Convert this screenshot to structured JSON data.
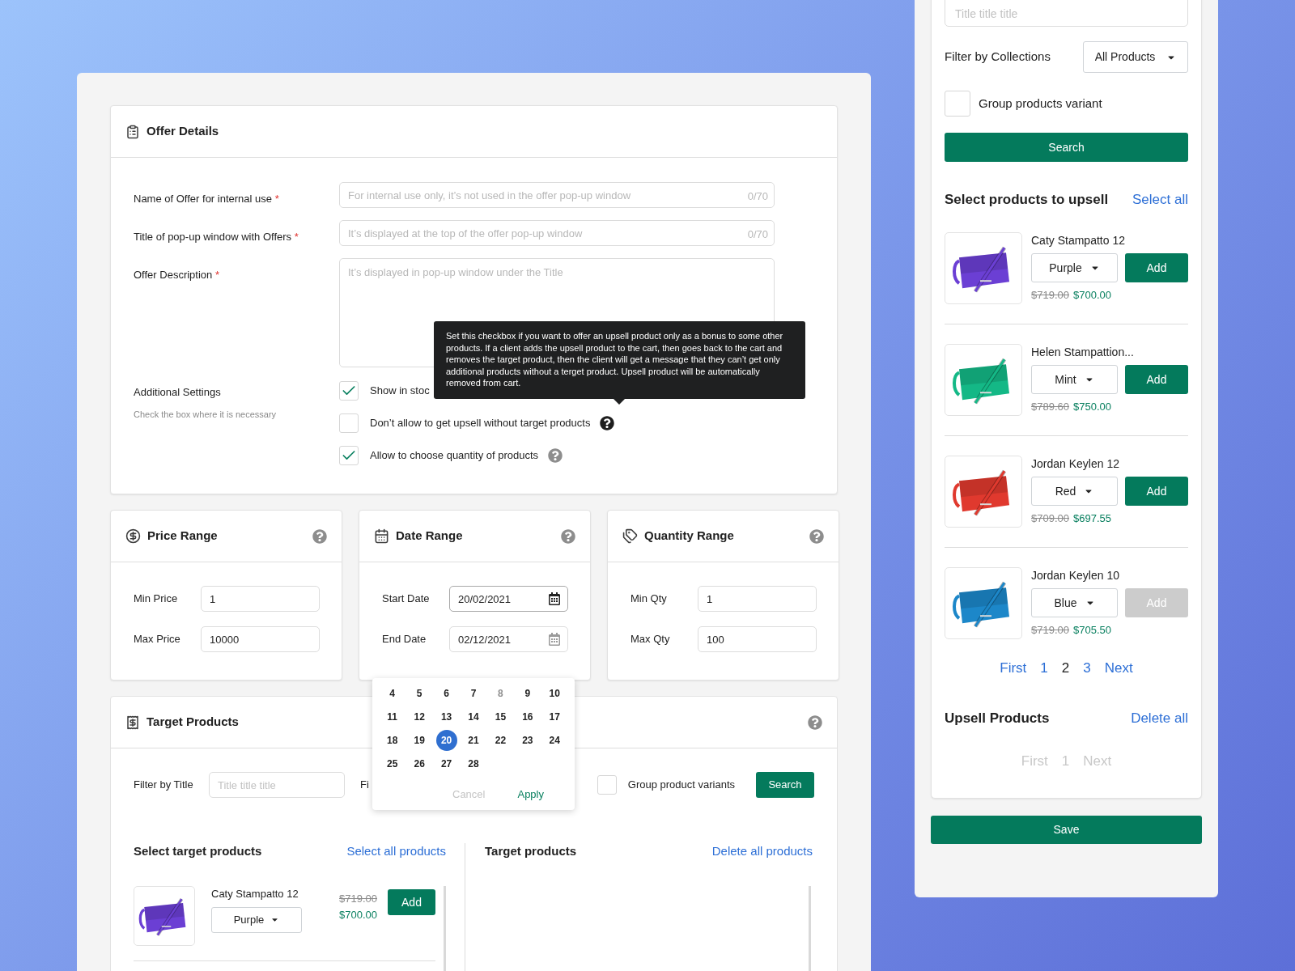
{
  "offer_details": {
    "title": "Offer Details",
    "fields": [
      {
        "kind": "input",
        "label": "Name of Offer for internal use",
        "required_mark": "*",
        "placeholder": "For internal use only, it’s not used in the offer pop-up window",
        "counter": "0/70"
      },
      {
        "kind": "input",
        "label": "Title of pop-up window with Offers",
        "required_mark": "*",
        "placeholder": "It’s displayed at the top of the offer pop-up window",
        "counter": "0/70"
      },
      {
        "kind": "textarea",
        "label": "Offer Description",
        "required_mark": "*",
        "placeholder": "It’s displayed in pop-up window under the Title"
      }
    ],
    "additional_settings": {
      "label": "Additional Settings",
      "hint": "Check the box where it is necessary",
      "options": [
        {
          "label": "Show in stoc",
          "checked": true,
          "help": false,
          "tooltip_open": false
        },
        {
          "label": "Don’t allow to get upsell without target products",
          "checked": false,
          "help": true,
          "tooltip_open": true,
          "tooltip": "Set this checkbox if you want to offer an upsell product only as a bonus to some other products. If a client adds the upsell product to the cart, then goes back to the cart and removes the target product, then the client will get a message that they can’t get only additional products without a terget product. Upsell product will be automatically removed from cart."
        },
        {
          "label": "Allow to choose quantity of products",
          "checked": true,
          "help": true,
          "tooltip_open": false
        }
      ]
    }
  },
  "ranges": [
    {
      "kind": "price",
      "title": "Price Range",
      "fields": [
        {
          "label": "Min Price",
          "value": "1"
        },
        {
          "label": "Max Price",
          "value": "10000"
        }
      ]
    },
    {
      "kind": "date",
      "title": "Date Range",
      "fields": [
        {
          "label": "Start Date",
          "value": "20/02/2021",
          "active": true
        },
        {
          "label": "End Date",
          "value": "02/12/2021",
          "active": false
        }
      ]
    },
    {
      "kind": "quantity",
      "title": "Quantity Range",
      "fields": [
        {
          "label": "Min Qty",
          "value": "1"
        },
        {
          "label": "Max Qty",
          "value": "100"
        }
      ]
    }
  ],
  "calendar": {
    "days": [
      {
        "label": "4",
        "selected": false,
        "disabled": false
      },
      {
        "label": "5",
        "selected": false,
        "disabled": false
      },
      {
        "label": "6",
        "selected": false,
        "disabled": false
      },
      {
        "label": "7",
        "selected": false,
        "disabled": false
      },
      {
        "label": "8",
        "selected": false,
        "disabled": true
      },
      {
        "label": "9",
        "selected": false,
        "disabled": false
      },
      {
        "label": "10",
        "selected": false,
        "disabled": false
      },
      {
        "label": "11",
        "selected": false,
        "disabled": false
      },
      {
        "label": "12",
        "selected": false,
        "disabled": false
      },
      {
        "label": "13",
        "selected": false,
        "disabled": false
      },
      {
        "label": "14",
        "selected": false,
        "disabled": false
      },
      {
        "label": "15",
        "selected": false,
        "disabled": false
      },
      {
        "label": "16",
        "selected": false,
        "disabled": false
      },
      {
        "label": "17",
        "selected": false,
        "disabled": false
      },
      {
        "label": "18",
        "selected": false,
        "disabled": false
      },
      {
        "label": "19",
        "selected": false,
        "disabled": false
      },
      {
        "label": "20",
        "selected": true,
        "disabled": false
      },
      {
        "label": "21",
        "selected": false,
        "disabled": false
      },
      {
        "label": "22",
        "selected": false,
        "disabled": false
      },
      {
        "label": "23",
        "selected": false,
        "disabled": false
      },
      {
        "label": "24",
        "selected": false,
        "disabled": false
      },
      {
        "label": "25",
        "selected": false,
        "disabled": false
      },
      {
        "label": "26",
        "selected": false,
        "disabled": false
      },
      {
        "label": "27",
        "selected": false,
        "disabled": false
      },
      {
        "label": "28",
        "selected": false,
        "disabled": false
      }
    ],
    "buttons": [
      {
        "label": "Cancel",
        "disabled": true
      },
      {
        "label": "Apply",
        "disabled": false
      }
    ]
  },
  "target_products": {
    "title": "Target Products",
    "filter_label": "Filter by Title",
    "filter_placeholder": "Title title title",
    "cut_label": "Fi",
    "group_checkbox": {
      "label": "Group product variants",
      "checked": false
    },
    "search_button": "Search",
    "select_title": "Select target products",
    "select_all": "Select all products",
    "products": [
      {
        "name": "Caty Stampatto 12",
        "variant": "Purple",
        "old_price": "$719.00",
        "price": "$700.00",
        "color": "#6b3fd4",
        "add": "Add",
        "disabled": false
      }
    ],
    "target_title": "Target products",
    "delete_all": "Delete all products"
  },
  "upsell_panel": {
    "title_placeholder": "Title title title",
    "collections_label": "Filter by Collections",
    "collections_value": "All Products",
    "group_checkbox": {
      "label": "Group products variant",
      "checked": false
    },
    "search_button": "Search",
    "select_title": "Select products to upsell",
    "select_all": "Select all",
    "products": [
      {
        "name": "Caty Stampatto 12",
        "variant": "Purple",
        "old_price": "$719.00",
        "price": "$700.00",
        "color": "#6b3fd4",
        "add": "Add",
        "disabled": false
      },
      {
        "name": "Helen Stampattion...",
        "variant": "Mint",
        "old_price": "$789.60",
        "price": "$750.00",
        "color": "#14b886",
        "add": "Add",
        "disabled": false
      },
      {
        "name": "Jordan Keylen 12",
        "variant": "Red",
        "old_price": "$709.00",
        "price": "$697.55",
        "color": "#e0392e",
        "add": "Add",
        "disabled": false
      },
      {
        "name": "Jordan Keylen 10",
        "variant": "Blue",
        "old_price": "$719.00",
        "price": "$705.50",
        "color": "#1c87c9",
        "add": "Add",
        "disabled": true
      }
    ],
    "pagination": {
      "disabled": false,
      "first": "First",
      "pages": [
        {
          "label": "1",
          "selected": false
        },
        {
          "label": "2",
          "selected": true
        },
        {
          "label": "3",
          "selected": false
        }
      ],
      "next": "Next"
    },
    "upsell_title": "Upsell Products",
    "delete_all": "Delete all",
    "upsell_pagination": {
      "disabled": true,
      "first": "First",
      "pages": [
        {
          "label": "1",
          "selected": false
        }
      ],
      "next": "Next"
    },
    "save_button": "Save"
  }
}
